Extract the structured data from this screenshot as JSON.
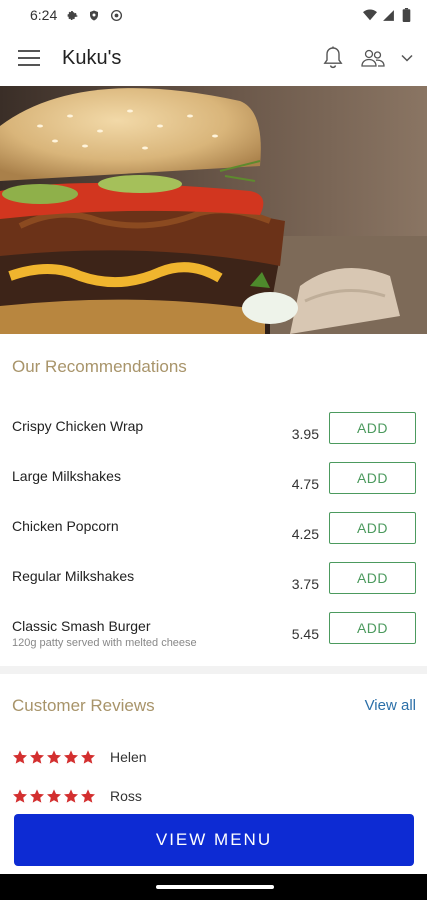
{
  "status_bar": {
    "time": "6:24",
    "icons": [
      "gear-icon",
      "shield-icon",
      "location-icon",
      "wifi-icon",
      "signal-icon",
      "battery-icon"
    ]
  },
  "app_bar": {
    "title": "Kuku's",
    "icons": [
      "menu-icon",
      "bell-icon",
      "people-icon",
      "chevron-down-icon"
    ]
  },
  "hero": {
    "subject": "burger-photo"
  },
  "recommendations": {
    "title": "Our Recommendations",
    "add_label": "ADD",
    "items": [
      {
        "name": "Crispy Chicken Wrap",
        "price": "3.95",
        "description": ""
      },
      {
        "name": "Large Milkshakes",
        "price": "4.75",
        "description": ""
      },
      {
        "name": "Chicken Popcorn",
        "price": "4.25",
        "description": ""
      },
      {
        "name": "Regular Milkshakes",
        "price": "3.75",
        "description": ""
      },
      {
        "name": "Classic Smash Burger",
        "price": "5.45",
        "description": "120g patty served with melted cheese"
      }
    ]
  },
  "reviews": {
    "title": "Customer Reviews",
    "view_all": "View all",
    "items": [
      {
        "name": "Helen",
        "rating": 5
      },
      {
        "name": "Ross",
        "rating": 5
      }
    ]
  },
  "cta": {
    "label": "VIEW MENU"
  },
  "colors": {
    "accent_gold": "#a8946a",
    "add_green": "#4c9a5e",
    "link_blue": "#2b6fa8",
    "cta_blue": "#0d2bd3",
    "star_red": "#d32f2f"
  }
}
